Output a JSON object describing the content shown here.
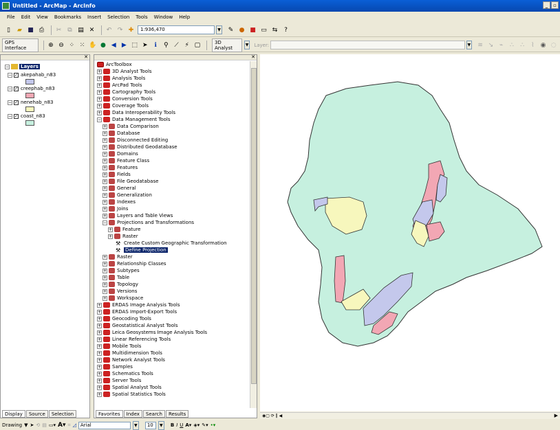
{
  "window": {
    "title": "Untitled - ArcMap - ArcInfo"
  },
  "menu": [
    "File",
    "Edit",
    "View",
    "Bookmarks",
    "Insert",
    "Selection",
    "Tools",
    "Window",
    "Help"
  ],
  "toolbar": {
    "scale": "1:936,470",
    "gps": "GPS Interface",
    "analyst": "3D Analyst",
    "layer_label": "Layer:"
  },
  "toc": {
    "root": "Layers",
    "layers": [
      {
        "name": "akepahab_n83",
        "color": "#c4c8ec"
      },
      {
        "name": "creephab_n83",
        "color": "#f2a7b4"
      },
      {
        "name": "nenehab_n83",
        "color": "#f7f7bd"
      },
      {
        "name": "coast_n83",
        "color": "#c6f0df"
      }
    ],
    "tabs": [
      "Display",
      "Source",
      "Selection"
    ]
  },
  "toolbox": {
    "root": "ArcToolbox",
    "items": [
      {
        "label": "3D Analyst Tools",
        "level": 0,
        "exp": "+"
      },
      {
        "label": "Analysis Tools",
        "level": 0,
        "exp": "+"
      },
      {
        "label": "ArcPad Tools",
        "level": 0,
        "exp": "+"
      },
      {
        "label": "Cartography Tools",
        "level": 0,
        "exp": "+"
      },
      {
        "label": "Conversion Tools",
        "level": 0,
        "exp": "+"
      },
      {
        "label": "Coverage Tools",
        "level": 0,
        "exp": "+"
      },
      {
        "label": "Data Interoperability Tools",
        "level": 0,
        "exp": "+"
      },
      {
        "label": "Data Management Tools",
        "level": 0,
        "exp": "−"
      },
      {
        "label": "Data Comparison",
        "level": 1,
        "exp": "+"
      },
      {
        "label": "Database",
        "level": 1,
        "exp": "+"
      },
      {
        "label": "Disconnected Editing",
        "level": 1,
        "exp": "+"
      },
      {
        "label": "Distributed Geodatabase",
        "level": 1,
        "exp": "+"
      },
      {
        "label": "Domains",
        "level": 1,
        "exp": "+"
      },
      {
        "label": "Feature Class",
        "level": 1,
        "exp": "+"
      },
      {
        "label": "Features",
        "level": 1,
        "exp": "+"
      },
      {
        "label": "Fields",
        "level": 1,
        "exp": "+"
      },
      {
        "label": "File Geodatabase",
        "level": 1,
        "exp": "+"
      },
      {
        "label": "General",
        "level": 1,
        "exp": "+"
      },
      {
        "label": "Generalization",
        "level": 1,
        "exp": "+"
      },
      {
        "label": "Indexes",
        "level": 1,
        "exp": "+"
      },
      {
        "label": "Joins",
        "level": 1,
        "exp": "+"
      },
      {
        "label": "Layers and Table Views",
        "level": 1,
        "exp": "+"
      },
      {
        "label": "Projections and Transformations",
        "level": 1,
        "exp": "−"
      },
      {
        "label": "Feature",
        "level": 2,
        "exp": "+"
      },
      {
        "label": "Raster",
        "level": 2,
        "exp": "+"
      },
      {
        "label": "Create Custom Geographic Transformation",
        "level": 2,
        "exp": "tool"
      },
      {
        "label": "Define Projection",
        "level": 2,
        "exp": "tool",
        "selected": true
      },
      {
        "label": "Raster",
        "level": 1,
        "exp": "+"
      },
      {
        "label": "Relationship Classes",
        "level": 1,
        "exp": "+"
      },
      {
        "label": "Subtypes",
        "level": 1,
        "exp": "+"
      },
      {
        "label": "Table",
        "level": 1,
        "exp": "+"
      },
      {
        "label": "Topology",
        "level": 1,
        "exp": "+"
      },
      {
        "label": "Versions",
        "level": 1,
        "exp": "+"
      },
      {
        "label": "Workspace",
        "level": 1,
        "exp": "+"
      },
      {
        "label": "ERDAS Image Analysis Tools",
        "level": 0,
        "exp": "+"
      },
      {
        "label": "ERDAS Import-Export Tools",
        "level": 0,
        "exp": "+"
      },
      {
        "label": "Geocoding Tools",
        "level": 0,
        "exp": "+"
      },
      {
        "label": "Geostatistical Analyst Tools",
        "level": 0,
        "exp": "+"
      },
      {
        "label": "Leica Geosystems Image Analysis Tools",
        "level": 0,
        "exp": "+"
      },
      {
        "label": "Linear Referencing Tools",
        "level": 0,
        "exp": "+"
      },
      {
        "label": "Mobile Tools",
        "level": 0,
        "exp": "+"
      },
      {
        "label": "Multidimension Tools",
        "level": 0,
        "exp": "+"
      },
      {
        "label": "Network Analyst Tools",
        "level": 0,
        "exp": "+"
      },
      {
        "label": "Samples",
        "level": 0,
        "exp": "+"
      },
      {
        "label": "Schematics Tools",
        "level": 0,
        "exp": "+"
      },
      {
        "label": "Server Tools",
        "level": 0,
        "exp": "+"
      },
      {
        "label": "Spatial Analyst Tools",
        "level": 0,
        "exp": "+"
      },
      {
        "label": "Spatial Statistics Tools",
        "level": 0,
        "exp": "+"
      }
    ],
    "tabs": [
      "Favorites",
      "Index",
      "Search",
      "Results"
    ]
  },
  "drawbar": {
    "drawing": "Drawing",
    "font": "Arial",
    "size": "10"
  }
}
